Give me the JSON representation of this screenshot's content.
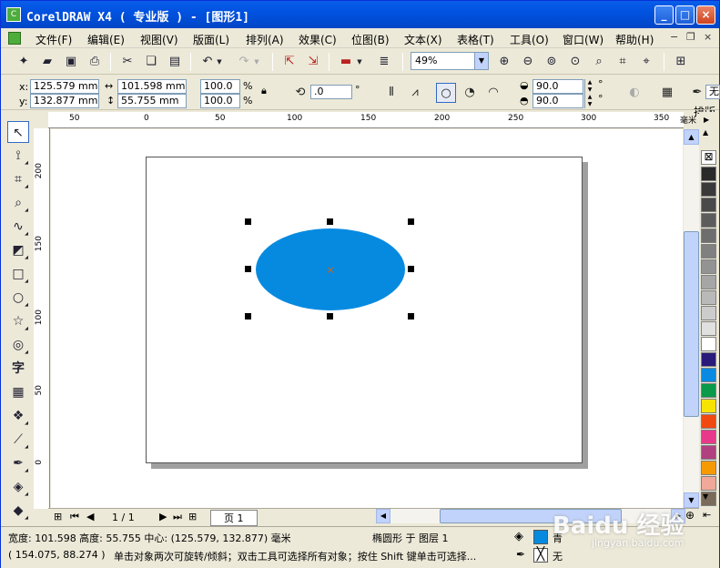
{
  "window": {
    "title": "CorelDRAW X4 ( 专业版 ) - [图形1]",
    "buttons": {
      "minimize": "_",
      "maximize": "□",
      "close": "×"
    }
  },
  "menu": [
    "文件(F)",
    "编辑(E)",
    "视图(V)",
    "版面(L)",
    "排列(A)",
    "效果(C)",
    "位图(B)",
    "文本(X)",
    "表格(T)",
    "工具(O)",
    "窗口(W)",
    "帮助(H)"
  ],
  "toolbar": {
    "zoom": "49%",
    "snap_label": "排版"
  },
  "property_bar": {
    "x_label": "x:",
    "x_value": "125.579 mm",
    "y_label": "y:",
    "y_value": "132.877 mm",
    "width_value": "101.598 mm",
    "height_value": "55.755 mm",
    "scale_w": "100.0",
    "scale_h": "100.0",
    "percent": "%",
    "rotation": ".0",
    "degree": "°",
    "start_angle": "90.0",
    "end_angle": "90.0",
    "outline_label": "无"
  },
  "ruler": {
    "unit": "毫米",
    "h_ticks": [
      "50",
      "0",
      "50",
      "100",
      "150",
      "200",
      "250",
      "300",
      "350"
    ],
    "v_ticks": [
      "200",
      "150",
      "100",
      "50",
      "0"
    ]
  },
  "canvas": {
    "ellipse_color": "#068ae0",
    "center_marker": "×"
  },
  "page_nav": {
    "page_count": "1 / 1",
    "page_tab": "页 1"
  },
  "palette": [
    "#2a2a2a",
    "#3a3a3a",
    "#4a4a4a",
    "#5c5c5c",
    "#6e6e6e",
    "#808080",
    "#939393",
    "#a6a6a6",
    "#b9b9b9",
    "#cccccc",
    "#e0e0e0",
    "#ffffff",
    "#2a1a7a",
    "#0a8ae0",
    "#0a9a4a",
    "#f6e400",
    "#f04a12",
    "#e83a8a",
    "#b04080",
    "#f59a00",
    "#f0a898",
    "#7a6a5a"
  ],
  "status": {
    "size_info": "宽度: 101.598 高度: 55.755 中心: (125.579, 132.877) 毫米",
    "object_info": "椭圆形 于 图层 1",
    "cursor_pos": "( 154.075, 88.274 )",
    "hint": "单击对象两次可旋转/倾斜；双击工具可选择所有对象；按住 Shift 键单击可选择...",
    "fill_label": "青",
    "fill_color": "#068ae0",
    "outline_label": "无"
  },
  "watermark": {
    "text": "Baidu 经验",
    "sub": "jingyan.baidu.com"
  }
}
